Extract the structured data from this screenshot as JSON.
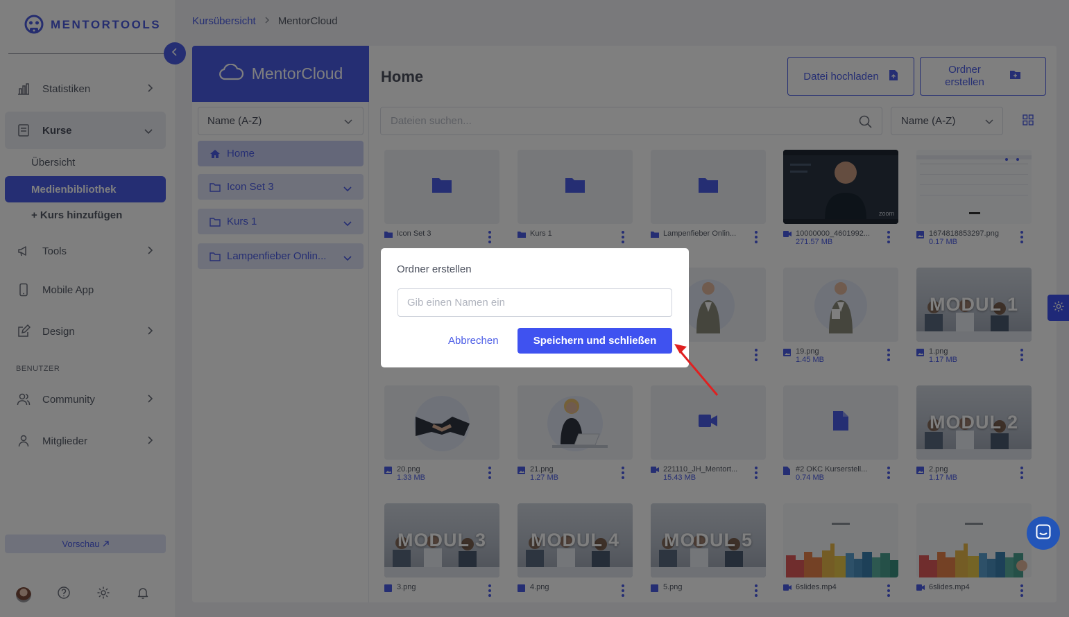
{
  "app": {
    "logo_text": "MENTORTOOLS"
  },
  "sidebar": {
    "items": [
      {
        "label": "Statistiken"
      },
      {
        "label": "Kurse"
      },
      {
        "label": "Tools"
      },
      {
        "label": "Mobile App"
      },
      {
        "label": "Design"
      },
      {
        "label": "Community"
      },
      {
        "label": "Mitglieder"
      }
    ],
    "sub_items": [
      "Übersicht",
      "Medienbibliothek",
      "+ Kurs hinzufügen"
    ],
    "section_label": "BENUTZER",
    "preview_label": "Vorschau"
  },
  "breadcrumb": {
    "parent": "Kursübersicht",
    "current": "MentorCloud"
  },
  "library": {
    "cloud_title": "MentorCloud",
    "sort_value": "Name (A-Z)",
    "tree": [
      {
        "label": "Home"
      },
      {
        "label": "Icon Set 3"
      },
      {
        "label": "Kurs 1"
      },
      {
        "label": "Lampenfieber Onlin..."
      }
    ],
    "title": "Home",
    "upload_label": "Datei hochladen",
    "create_folder_label_1": "Ordner",
    "create_folder_label_2": "erstellen",
    "search_placeholder": "Dateien suchen...",
    "sort2_value": "Name (A-Z)"
  },
  "files": [
    {
      "name": "Icon Set 3",
      "size": ""
    },
    {
      "name": "Kurs 1",
      "size": ""
    },
    {
      "name": "Lampenfieber Onlin...",
      "size": ""
    },
    {
      "name": "10000000_4601992...",
      "size": "271.57 MB"
    },
    {
      "name": "1674818853297.png",
      "size": "0.17 MB"
    },
    {
      "name": "19.png",
      "size": "1.45 MB"
    },
    {
      "name": "1.png",
      "size": "1.17 MB"
    },
    {
      "name": "20.png",
      "size": "1.33 MB"
    },
    {
      "name": "21.png",
      "size": "1.27 MB"
    },
    {
      "name": "221110_JH_Mentort...",
      "size": "15.43 MB"
    },
    {
      "name": "#2 OKC Kurserstell...",
      "size": "0.74 MB"
    },
    {
      "name": "2.png",
      "size": "1.17 MB"
    },
    {
      "name": "3.png",
      "size": ""
    },
    {
      "name": "4.png",
      "size": ""
    },
    {
      "name": "5.png",
      "size": ""
    },
    {
      "name": "6slides.mp4",
      "size": ""
    },
    {
      "name": "6slides.mp4",
      "size": ""
    }
  ],
  "thumb_text": {
    "m1": "MODUL 1",
    "m2": "MODUL 2",
    "m3": "MODUL 3",
    "m4": "MODUL 4",
    "m5": "MODUL 5",
    "zoom": "zoom"
  },
  "modal": {
    "title": "Ordner erstellen",
    "placeholder": "Gib einen Namen ein",
    "cancel_label": "Abbrechen",
    "save_label": "Speichern und schließen"
  },
  "colors": {
    "accent": "#4b5ce6",
    "annotation_arrow": "#e02020"
  }
}
